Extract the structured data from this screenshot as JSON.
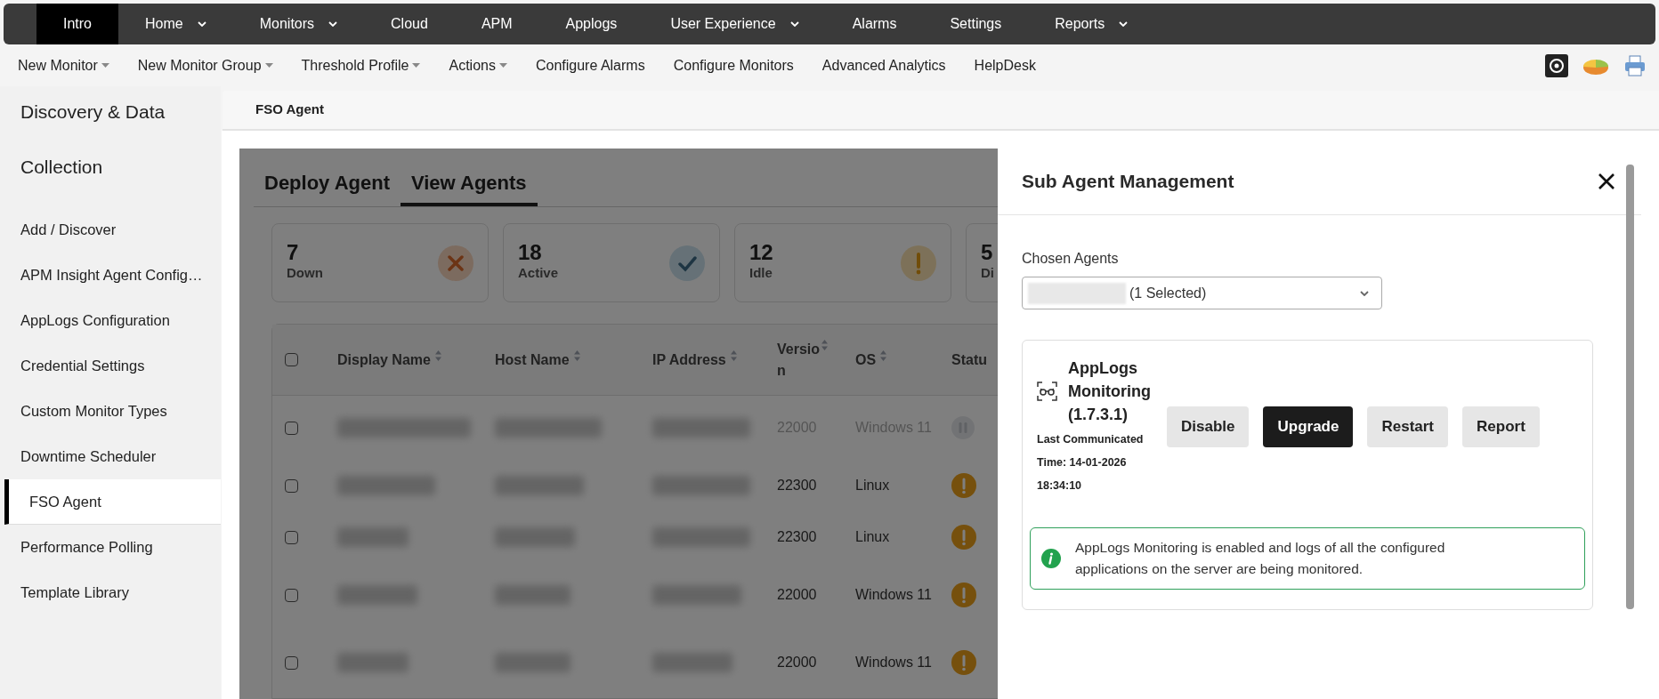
{
  "top_nav": [
    {
      "label": "Intro",
      "selected": true,
      "dropdown": false
    },
    {
      "label": "Home",
      "selected": false,
      "dropdown": true
    },
    {
      "label": "Monitors",
      "selected": false,
      "dropdown": true
    },
    {
      "label": "Cloud",
      "selected": false,
      "dropdown": false
    },
    {
      "label": "APM",
      "selected": false,
      "dropdown": false
    },
    {
      "label": "Applogs",
      "selected": false,
      "dropdown": false
    },
    {
      "label": "User Experience",
      "selected": false,
      "dropdown": true
    },
    {
      "label": "Alarms",
      "selected": false,
      "dropdown": false
    },
    {
      "label": "Settings",
      "selected": false,
      "dropdown": false
    },
    {
      "label": "Reports",
      "selected": false,
      "dropdown": true
    }
  ],
  "sub_nav": [
    {
      "label": "New Monitor",
      "dropdown": true
    },
    {
      "label": "New Monitor Group",
      "dropdown": true
    },
    {
      "label": "Threshold Profile",
      "dropdown": true
    },
    {
      "label": "Actions",
      "dropdown": true
    },
    {
      "label": "Configure Alarms",
      "dropdown": false
    },
    {
      "label": "Configure Monitors",
      "dropdown": false
    },
    {
      "label": "Advanced Analytics",
      "dropdown": false
    },
    {
      "label": "HelpDesk",
      "dropdown": false
    }
  ],
  "sidebar": {
    "title_lines": [
      "Discovery & Data",
      "Collection"
    ],
    "items": [
      {
        "label": "Add / Discover",
        "selected": false
      },
      {
        "label": "APM Insight Agent Config…",
        "selected": false
      },
      {
        "label": "AppLogs Configuration",
        "selected": false
      },
      {
        "label": "Credential Settings",
        "selected": false
      },
      {
        "label": "Custom Monitor Types",
        "selected": false
      },
      {
        "label": "Downtime Scheduler",
        "selected": false
      },
      {
        "label": "FSO Agent",
        "selected": true
      },
      {
        "label": "Performance Polling",
        "selected": false
      },
      {
        "label": "Template Library",
        "selected": false
      }
    ]
  },
  "page_title": "FSO Agent",
  "tabs": [
    {
      "label": "Deploy Agent",
      "selected": false
    },
    {
      "label": "View Agents",
      "selected": true
    }
  ],
  "stats": [
    {
      "count": "7",
      "label": "Down",
      "kind": "down"
    },
    {
      "count": "18",
      "label": "Active",
      "kind": "active"
    },
    {
      "count": "12",
      "label": "Idle",
      "kind": "idle"
    },
    {
      "count": "5",
      "label": "Di",
      "kind": "none"
    }
  ],
  "table": {
    "header_checked": false,
    "columns": [
      {
        "label": "Display Name",
        "sortable": true
      },
      {
        "label": "Host Name",
        "sortable": true
      },
      {
        "label": "IP Address",
        "sortable": true
      },
      {
        "label": "Versio n",
        "sortable": true
      },
      {
        "label": "OS",
        "sortable": true
      },
      {
        "label": "Statu",
        "sortable": false
      }
    ],
    "rows": [
      {
        "checked": false,
        "disabled": true,
        "version": "22000",
        "os": "Windows 11",
        "kind": "paused"
      },
      {
        "checked": false,
        "disabled": false,
        "version": "22300",
        "os": "Linux",
        "kind": "idle"
      },
      {
        "checked": false,
        "disabled": false,
        "version": "22300",
        "os": "Linux",
        "kind": "idle"
      },
      {
        "checked": false,
        "disabled": false,
        "version": "22000",
        "os": "Windows 11",
        "kind": "idle"
      },
      {
        "checked": false,
        "disabled": false,
        "version": "22000",
        "os": "Windows 11",
        "kind": "idle"
      }
    ]
  },
  "panel": {
    "title": "Sub Agent Management",
    "field_label": "Chosen Agents",
    "select_value": "(1 Selected)",
    "agent": {
      "name": "AppLogs Monitoring (1.7.3.1)",
      "last_communicated": "Last Communicated Time: 14-01-2026 18:34:10",
      "buttons": [
        {
          "label": "Disable",
          "primary": false
        },
        {
          "label": "Upgrade",
          "primary": true
        },
        {
          "label": "Restart",
          "primary": false
        },
        {
          "label": "Report",
          "primary": false
        }
      ],
      "info": "AppLogs Monitoring is enabled and logs of all the configured applications on the server are being monitored."
    }
  }
}
